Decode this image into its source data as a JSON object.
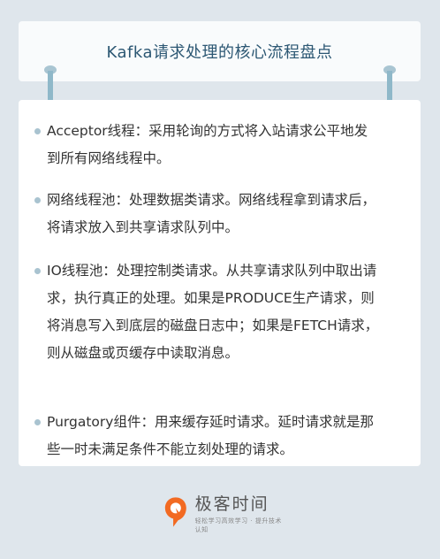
{
  "header": {
    "title": "Kafka请求处理的核心流程盘点"
  },
  "items": [
    {
      "text": "Acceptor线程：采用轮询的方式将入站请求公平地发到所有网络线程中。"
    },
    {
      "text": "网络线程池：处理数据类请求。网络线程拿到请求后，将请求放入到共享请求队列中。"
    },
    {
      "text": "IO线程池：处理控制类请求。从共享请求队列中取出请求，执行真正的处理。如果是PRODUCE生产请求，则将消息写入到底层的磁盘日志中；如果是FETCH请求，则从磁盘或页缓存中读取消息。"
    },
    {
      "text": "Purgatory组件：用来缓存延时请求。延时请求就是那些一时未满足条件不能立刻处理的请求。"
    }
  ],
  "footer": {
    "brand": "极客时间",
    "slogan": "轻松学习高效学习 · 提升技术认知"
  },
  "colors": {
    "background": "#dfe6ec",
    "title": "#2c5773",
    "bullet": "#a9c3d0",
    "logo_orange": "#f26a22"
  },
  "icons": {
    "logo": "geektime-logo-icon"
  }
}
